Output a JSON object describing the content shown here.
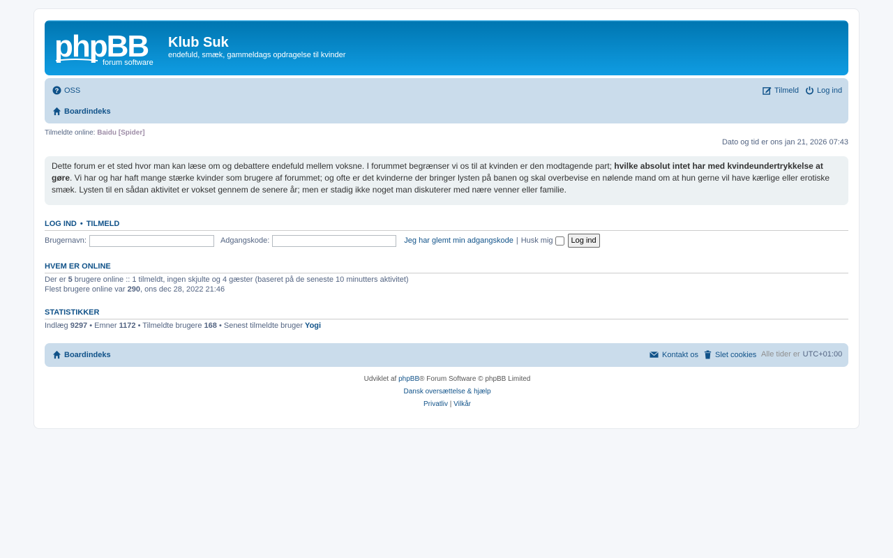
{
  "header": {
    "site_title": "Klub Suk",
    "site_description": "endefuld, smæk, gammeldags opdragelse til kvinder",
    "logo_text": "phpBB",
    "logo_subtext": "forum software"
  },
  "navbar": {
    "faq": "OSS",
    "register": "Tilmeld",
    "login": "Log ind",
    "index": "Boardindeks"
  },
  "online_now": {
    "label": "Tilmeldte online:",
    "users": "Baidu [Spider]"
  },
  "datetime": "Dato og tid er ons jan 21, 2026 07:43",
  "announcement": {
    "text1": "Dette forum er et sted hvor man kan læse om og debattere endefuld mellem voksne. I forummet begrænser vi os til at kvinden er den modtagende part; ",
    "bold": "hvilke absolut intet har med kvindeundertrykkelse at gøre",
    "text2": ". Vi har og har haft mange stærke kvinder som brugere af forummet; og ofte er det kvinderne der bringer lysten på banen og skal overbevise en nølende mand om at hun gerne vil have kærlige eller erotiske smæk. Lysten til en sådan aktivitet er vokset gennem de senere år; men er stadig ikke noget man diskuterer med nære venner eller familie."
  },
  "login_section": {
    "heading_login": "Log ind",
    "separator": "•",
    "heading_register": "Tilmeld",
    "username_label": "Brugernavn:",
    "password_label": "Adgangskode:",
    "forgot_link": "Jeg har glemt min adgangskode",
    "pipe": "|",
    "remember_label": "Husk mig",
    "login_button": "Log ind"
  },
  "who_is_online": {
    "heading": "Hvem er online",
    "line1_pre": "Der er ",
    "total": "5",
    "line1_post": " brugere online :: 1 tilmeldt, ingen skjulte og 4 gæster (baseret på de seneste 10 minutters aktivitet)",
    "line2_pre": "Flest brugere online var ",
    "max": "290",
    "line2_post": ", ons dec 28, 2022 21:46"
  },
  "statistics": {
    "heading": "Statistikker",
    "posts_label": "Indlæg",
    "posts": "9297",
    "topics_label": "• Emner",
    "topics": "1172",
    "members_label": "• Tilmeldte brugere",
    "members": "168",
    "newest_label": "• Senest tilmeldte bruger",
    "newest": "Yogi"
  },
  "footer_nav": {
    "index": "Boardindeks",
    "contact": "Kontakt os",
    "cookies": "Slet cookies",
    "tz_label": "Alle tider er",
    "tz": "UTC+01:00"
  },
  "copyright": {
    "powered_pre": "Udviklet af",
    "phpbb": "phpBB",
    "powered_post": "® Forum Software © phpBB Limited",
    "translation": "Dansk oversættelse & hjælp",
    "privacy": "Privatliv",
    "pipe": "|",
    "terms": "Vilkår"
  },
  "colors": {
    "header_blue": "#12a3eb",
    "nav_bg": "#cadceb",
    "link": "#105289",
    "spider": "#9e8da7"
  }
}
